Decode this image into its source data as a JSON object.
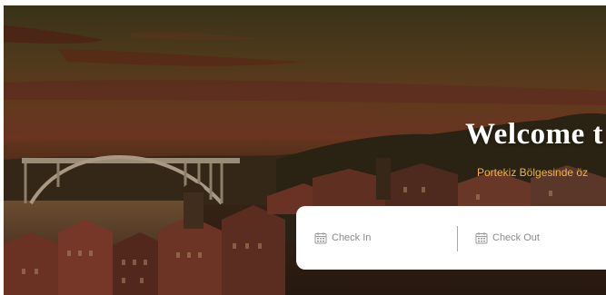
{
  "hero": {
    "title": "Welcome t",
    "subtitle": "Portekiz Bölgesinde öz"
  },
  "booking": {
    "check_in_placeholder": "Check In",
    "check_out_placeholder": "Check Out",
    "icon": "calendar-icon"
  },
  "colors": {
    "subtitle_accent": "#f2b54b",
    "bar_background": "#ffffff",
    "placeholder_text": "#8a8a8a"
  }
}
